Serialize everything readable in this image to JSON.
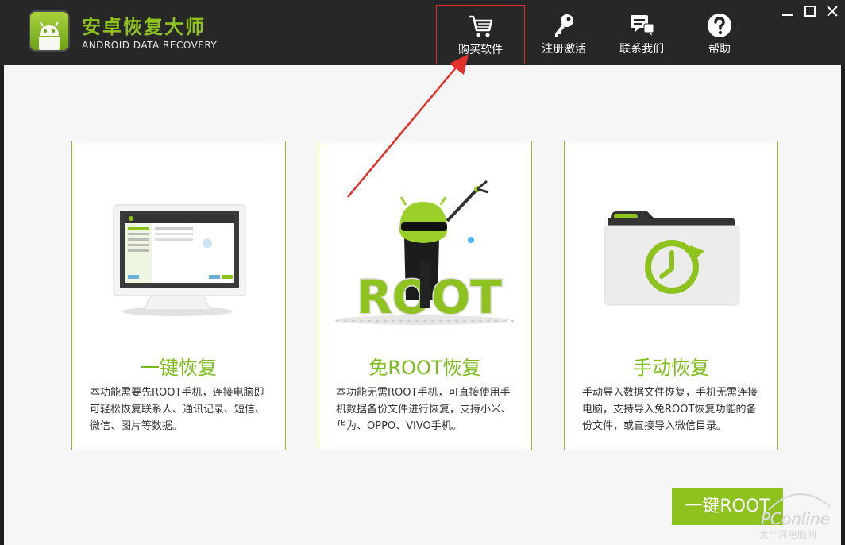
{
  "app": {
    "title": "安卓恢复大师",
    "subtitle": "ANDROID DATA RECOVERY"
  },
  "nav": {
    "items": [
      {
        "label": "购买软件",
        "icon": "cart-icon"
      },
      {
        "label": "注册激活",
        "icon": "key-icon"
      },
      {
        "label": "联系我们",
        "icon": "chat-icon"
      },
      {
        "label": "帮助",
        "icon": "help-icon"
      }
    ],
    "active": 0
  },
  "window_controls": [
    "minimize-icon",
    "maximize-icon",
    "close-icon"
  ],
  "cards": [
    {
      "title": "一键恢复",
      "desc": "本功能需要先ROOT手机，连接电脑即可轻松恢复联系人、通讯记录、短信、微信、图片等数据。",
      "art": "monitor-illustration"
    },
    {
      "title": "免ROOT恢复",
      "desc": "本功能无需ROOT手机，可直接使用手机数据备份文件进行恢复，支持小米、华为、OPPO、VIVO手机。",
      "art": "root-robot-illustration",
      "art_text": "ROOT"
    },
    {
      "title": "手动恢复",
      "desc": "手动导入数据文件恢复，手机无需连接电脑，支持导入免ROOT恢复功能的备份文件，或直接导入微信目录。",
      "art": "folder-restore-illustration"
    }
  ],
  "root_button": {
    "label": "一键ROOT"
  },
  "watermark": {
    "brand": "PConline",
    "sub": "太平洋电脑网"
  },
  "colors": {
    "titlebar": "#272727",
    "accent": "#8dc21f",
    "highlight_box": "#e0302b",
    "content_bg": "#f6f6f6"
  }
}
